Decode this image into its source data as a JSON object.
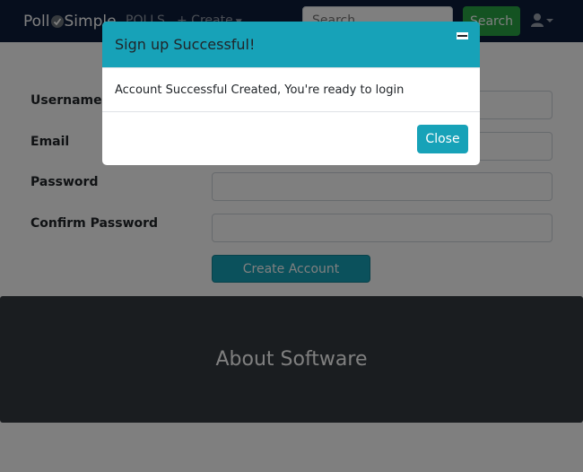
{
  "navbar": {
    "brand_left": "Poll",
    "brand_right": "Simple",
    "polls_label": "POLLS",
    "create_label": "+ Create",
    "search_placeholder": "Search",
    "search_button": "Search",
    "user_icon": "user-icon"
  },
  "form": {
    "username_label": "Username",
    "email_label": "Email",
    "password_label": "Password",
    "confirm_label": "Confirm Password",
    "submit_label": "Create Account"
  },
  "footer": {
    "about_title": "About Software"
  },
  "modal": {
    "title": "Sign up Successful!",
    "message": "Account Successful Created, You're ready to login",
    "close_button": "Close"
  },
  "colors": {
    "navbar_bg": "#0c1d3a",
    "accent_info": "#17a2b8",
    "success": "#28a745",
    "footer_bg": "#343a40"
  }
}
